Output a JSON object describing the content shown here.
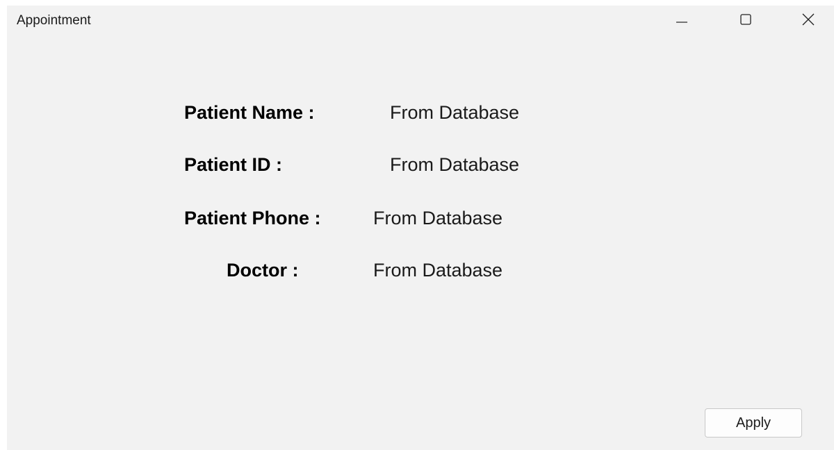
{
  "window": {
    "title": "Appointment",
    "controls": {
      "minimize_icon": "minimize-icon",
      "maximize_icon": "maximize-icon",
      "close_icon": "close-icon"
    }
  },
  "form": {
    "fields": [
      {
        "label": "Patient Name :",
        "value": "From Database"
      },
      {
        "label": "Patient ID :",
        "value": "From Database"
      },
      {
        "label": "Patient Phone :",
        "value": "From Database"
      },
      {
        "label": "Doctor :",
        "value": "From Database"
      }
    ]
  },
  "actions": {
    "apply_label": "Apply"
  },
  "colors": {
    "window_background": "#f2f2f2",
    "text": "#000000"
  }
}
